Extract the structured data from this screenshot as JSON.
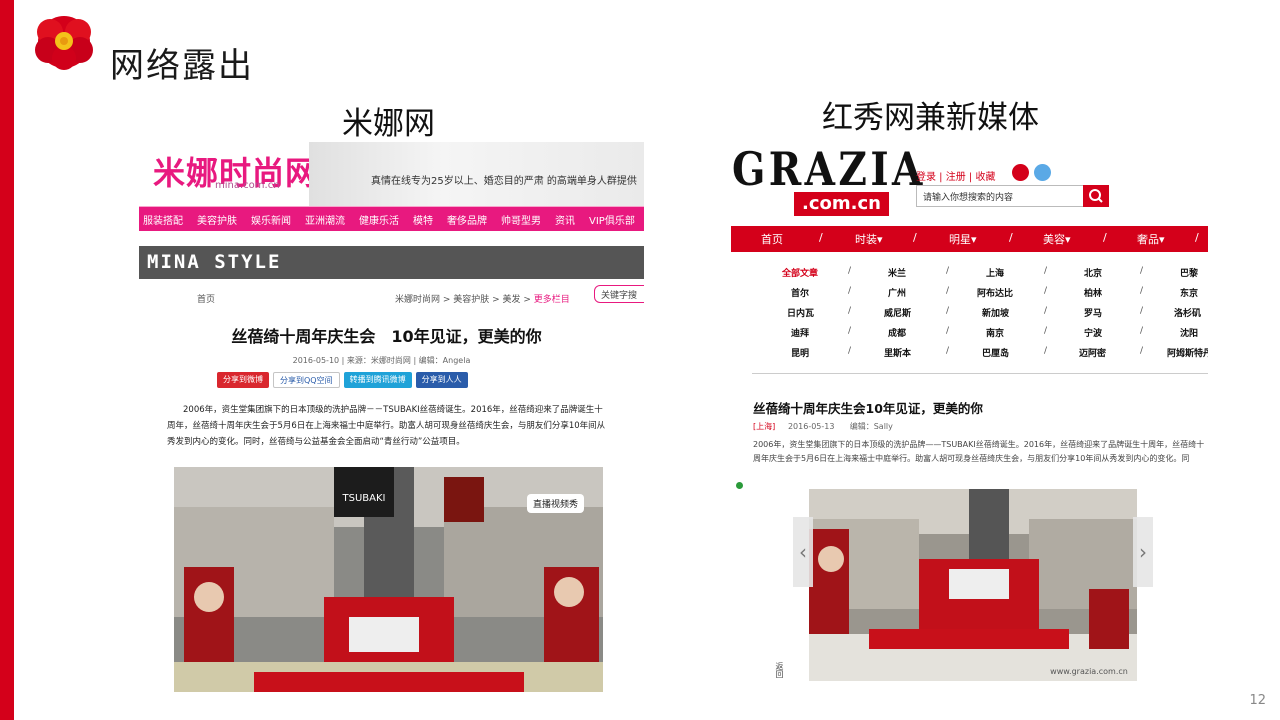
{
  "slide": {
    "title": "网络露出",
    "page_number": "12",
    "left_caption": "米娜网",
    "right_caption": "红秀网兼新媒体"
  },
  "mina": {
    "logo": "米娜时尚网",
    "logo_sub": "mina.com.cn",
    "banner_text": "真情在线专为25岁以上、婚恋目的严肃 的高端单身人群提供",
    "nav": [
      "服装搭配",
      "美容护肤",
      "娱乐新闻",
      "亚洲潮流",
      "健康乐活",
      "模特",
      "奢侈品牌",
      "帅哥型男",
      "资讯",
      "VIP俱乐部"
    ],
    "style_bar": "MINA STYLE",
    "crumb_home": "首页",
    "crumb_path": "米娜时尚网 > 美容护肤 > 美发 > ",
    "crumb_more": "更多栏目",
    "keyword_placeholder": "关键字搜",
    "article_title": "丝蓓绮十周年庆生会　10年见证，更美的你",
    "article_meta": "2016-05-10 | 来源：米娜时尚网 | 编辑：Angela",
    "share_buttons": [
      "分享到微博",
      "分享到QQ空间",
      "转播到腾讯微博",
      "分享到人人"
    ],
    "article_body": "2006年，资生堂集团旗下的日本顶级的洗护品牌－－TSUBAKI丝蓓绮诞生。2016年，丝蓓绮迎来了品牌诞生十周年，丝蓓绮十周年庆生会于5月6日在上海来福士中庭举行。助富人胡可现身丝蓓绮庆生会，与朋友们分享10年间从秀发到内心的变化。同时，丝蓓绮与公益基金会全面启动“青丝行动”公益项目。",
    "live_button": "直播视频秀",
    "photo_sign": "TSUBAKI"
  },
  "grazia": {
    "logo": "GRAZIA",
    "logo_domain": ".com.cn",
    "top_links": "登录 | 注册 | 收藏",
    "search_placeholder": "请输入你想搜索的内容",
    "nav": [
      "首页",
      "时装▾",
      "明星▾",
      "美容▾",
      "奢品▾"
    ],
    "cities": [
      [
        "全部文章",
        "米兰",
        "上海",
        "北京",
        "巴黎"
      ],
      [
        "首尔",
        "广州",
        "阿布达比",
        "柏林",
        "东京"
      ],
      [
        "日内瓦",
        "威尼斯",
        "新加坡",
        "罗马",
        "洛杉矶"
      ],
      [
        "迪拜",
        "成都",
        "南京",
        "宁波",
        "沈阳"
      ],
      [
        "昆明",
        "里斯本",
        "巴厘岛",
        "迈阿密",
        "阿姆斯特丹"
      ]
    ],
    "article_title": "丝蓓绮十周年庆生会10年见证，更美的你",
    "meta_loc": "[上海]",
    "meta_date": "2016-05-13",
    "meta_editor": "编辑：Sally",
    "article_body": "2006年，资生堂集团旗下的日本顶级的洗护品牌——TSUBAKI丝蓓绮诞生。2016年，丝蓓绮迎来了品牌诞生十周年，丝蓓绮十周年庆生会于5月6日在上海来福士中庭举行。助富人胡可现身丝蓓绮庆生会，与朋友们分享10年间从秀发到内心的变化。同",
    "photo_watermark": "www.grazia.com.cn",
    "side_text": "返回",
    "arrow_left": "‹",
    "arrow_right": "›"
  }
}
